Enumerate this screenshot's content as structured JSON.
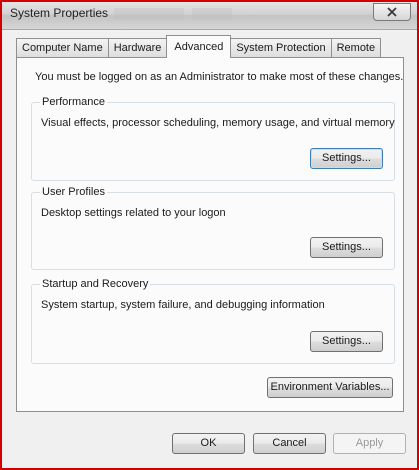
{
  "window": {
    "title": "System Properties"
  },
  "tabs": [
    {
      "label": "Computer Name",
      "active": false
    },
    {
      "label": "Hardware",
      "active": false
    },
    {
      "label": "Advanced",
      "active": true
    },
    {
      "label": "System Protection",
      "active": false
    },
    {
      "label": "Remote",
      "active": false
    }
  ],
  "advanced": {
    "intro": "You must be logged on as an Administrator to make most of these changes.",
    "performance": {
      "title": "Performance",
      "description": "Visual effects, processor scheduling, memory usage, and virtual memory",
      "button": "Settings..."
    },
    "user_profiles": {
      "title": "User Profiles",
      "description": "Desktop settings related to your logon",
      "button": "Settings..."
    },
    "startup_recovery": {
      "title": "Startup and Recovery",
      "description": "System startup, system failure, and debugging information",
      "button": "Settings..."
    },
    "env_button": "Environment Variables..."
  },
  "footer": {
    "ok": "OK",
    "cancel": "Cancel",
    "apply": "Apply"
  },
  "icons": {
    "close": "close-icon"
  },
  "colors": {
    "window_border": "#d40000",
    "focus_border": "#3c7fb1"
  }
}
